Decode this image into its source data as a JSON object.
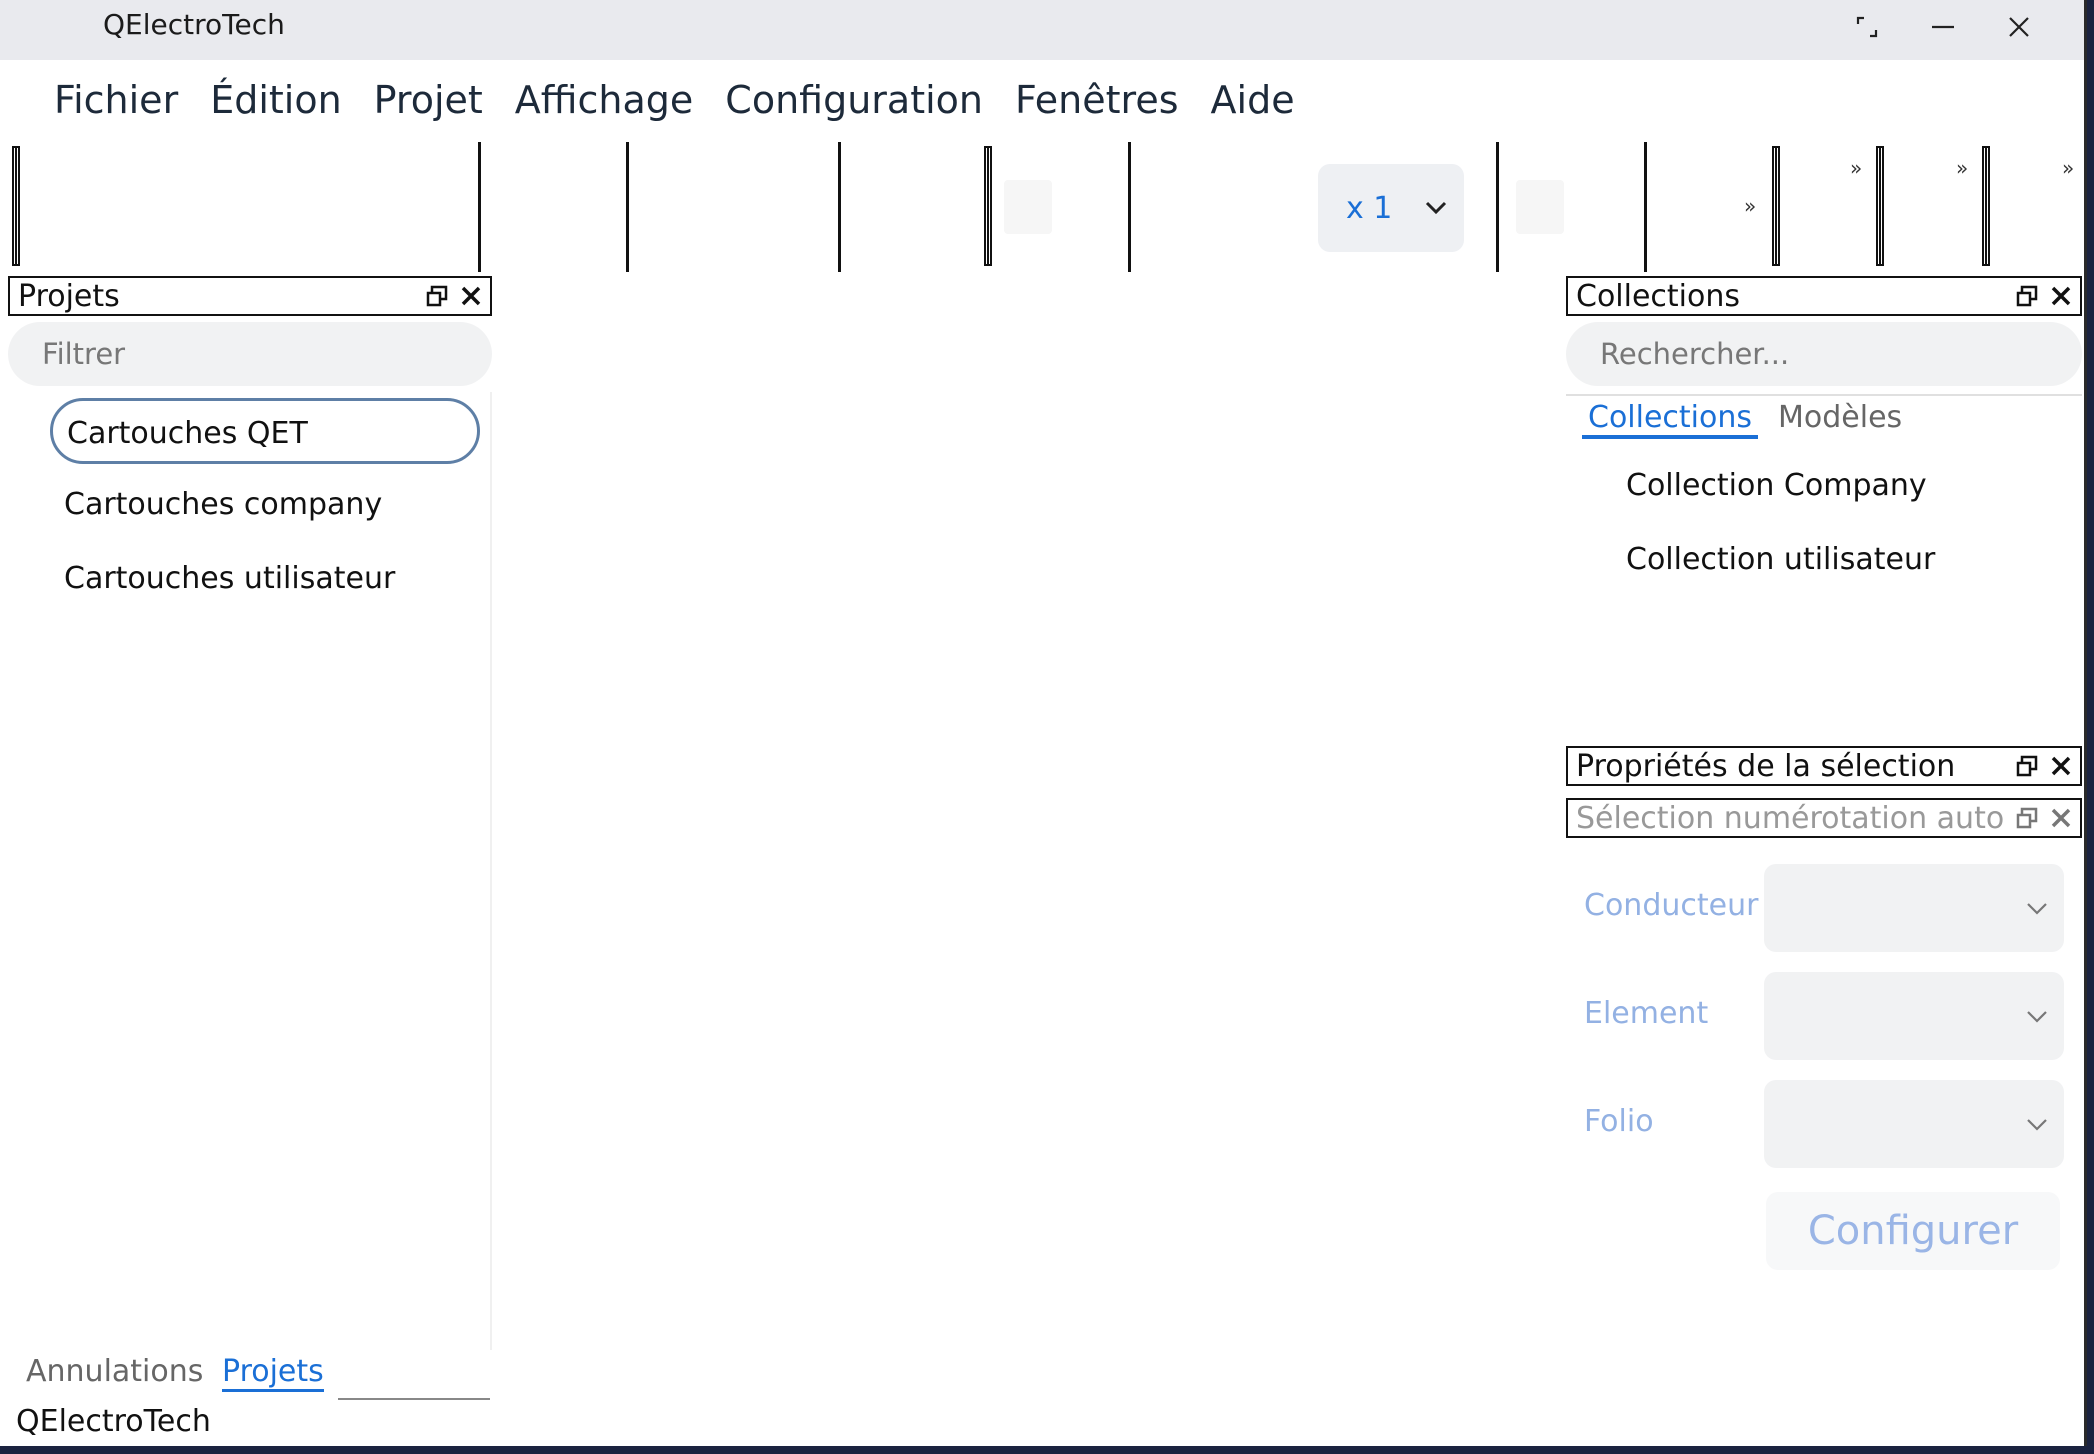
{
  "window": {
    "title": "QElectroTech",
    "controls": [
      "restore-icon",
      "minimize-icon",
      "close-icon"
    ]
  },
  "menubar": {
    "items": [
      "Fichier",
      "Édition",
      "Projet",
      "Affichage",
      "Configuration",
      "Fenêtres",
      "Aide"
    ]
  },
  "toolbar": {
    "zoom_value": "x 1",
    "overflow_glyph": "»"
  },
  "projects_panel": {
    "title": "Projets",
    "filter_placeholder": "Filtrer",
    "items": [
      {
        "label": "Cartouches QET",
        "selected": true
      },
      {
        "label": "Cartouches company",
        "selected": false
      },
      {
        "label": "Cartouches utilisateur",
        "selected": false
      }
    ],
    "bottom_tabs": [
      {
        "label": "Annulations",
        "active": false
      },
      {
        "label": "Projets",
        "active": true
      }
    ]
  },
  "status_bar": {
    "text": "QElectroTech"
  },
  "collections_panel": {
    "title": "Collections",
    "search_placeholder": "Rechercher...",
    "tabs": [
      {
        "label": "Collections",
        "active": true
      },
      {
        "label": "Modèles",
        "active": false
      }
    ],
    "items": [
      "Collection Company",
      "Collection utilisateur"
    ]
  },
  "selection_properties_panel": {
    "title": "Propriétés de la sélection"
  },
  "auto_numbering_panel": {
    "title": "Sélection numérotation auto",
    "fields": [
      {
        "label": "Conducteur",
        "value": ""
      },
      {
        "label": "Element",
        "value": ""
      },
      {
        "label": "Folio",
        "value": ""
      }
    ],
    "configure_label": "Configurer"
  },
  "colors": {
    "accent": "#1a6fd6",
    "disabled_label": "#93b1e3",
    "selection_border": "#5e7fa6"
  }
}
